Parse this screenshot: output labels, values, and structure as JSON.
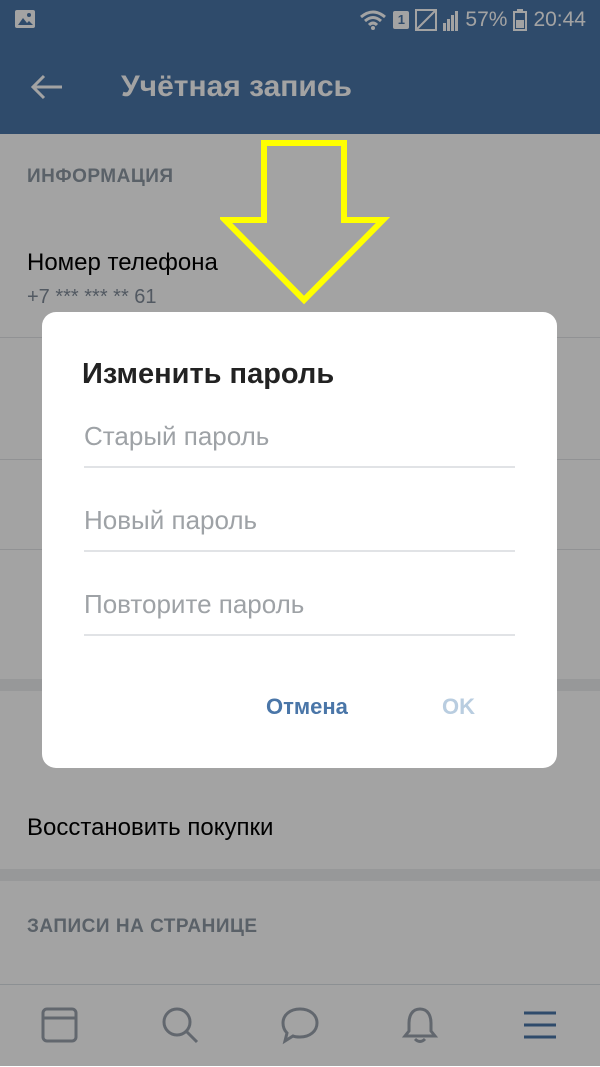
{
  "status_bar": {
    "sim_slot": "1",
    "battery": "57%",
    "time": "20:44"
  },
  "app_bar": {
    "title": "Учётная запись"
  },
  "sections": {
    "info_header": "ИНФОРМАЦИЯ",
    "phone_title": "Номер телефона",
    "phone_value": "+7 *** *** ** 61",
    "restore_purchases": "Восстановить покупки",
    "posts_header": "ЗАПИСИ НА СТРАНИЦЕ"
  },
  "dialog": {
    "title": "Изменить пароль",
    "old_password_placeholder": "Старый пароль",
    "new_password_placeholder": "Новый пароль",
    "repeat_password_placeholder": "Повторите пароль",
    "cancel_label": "Отмена",
    "ok_label": "OK"
  },
  "colors": {
    "brand": "#4a76a8",
    "annotation_arrow": "#ffff00"
  },
  "icons": {
    "status": [
      "gallery-icon",
      "wifi-icon",
      "sim-icon",
      "signal-empty-icon",
      "signal-icon",
      "battery-icon"
    ],
    "nav": [
      "news-icon",
      "search-icon",
      "messages-icon",
      "notifications-icon",
      "menu-icon"
    ]
  }
}
